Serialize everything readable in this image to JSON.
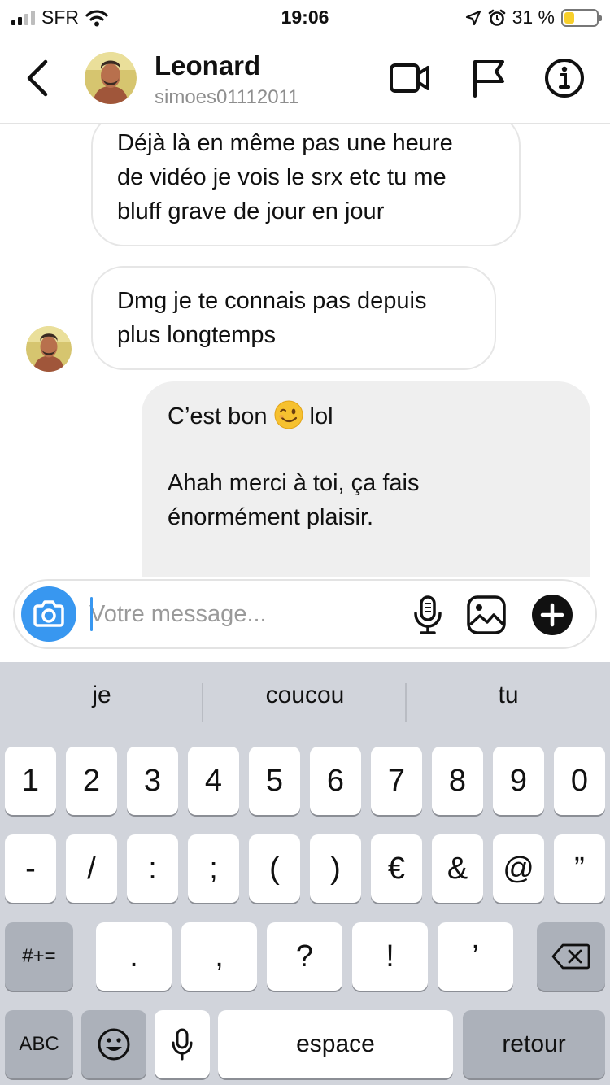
{
  "status_bar": {
    "carrier": "SFR",
    "time": "19:06",
    "battery_percent": "31 %",
    "battery_level": 0.31,
    "icons": [
      "signal-icon",
      "wifi-icon",
      "location-icon",
      "alarm-icon",
      "battery-icon"
    ]
  },
  "header": {
    "contact_name": "Leonard",
    "username": "simoes01112011",
    "icons": [
      "back-chevron-icon",
      "video-call-icon",
      "flag-icon",
      "info-icon"
    ]
  },
  "messages": [
    {
      "direction": "incoming",
      "lines": [
        "Déjà là en même pas une heure",
        "de vidéo je vois le srx etc tu me",
        "bluff grave de jour en jour"
      ]
    },
    {
      "direction": "incoming",
      "lines": [
        "Dmg je te connais pas depuis",
        "plus longtemps"
      ]
    },
    {
      "direction": "outgoing",
      "line1_before": "C’est bon",
      "line1_emoji": "winking-face-emoji",
      "line1_after": "lol",
      "lines": [
        "Ahah merci à toi, ça fais",
        "énormément plaisir."
      ]
    }
  ],
  "composer": {
    "placeholder": "Votre message...",
    "value": "",
    "icons": [
      "camera-icon",
      "microphone-icon",
      "gallery-icon",
      "plus-icon"
    ]
  },
  "keyboard": {
    "suggestions": [
      "je",
      "coucou",
      "tu"
    ],
    "row1": [
      "1",
      "2",
      "3",
      "4",
      "5",
      "6",
      "7",
      "8",
      "9",
      "0"
    ],
    "row2": [
      "-",
      "/",
      ":",
      ";",
      "(",
      ")",
      "€",
      "&",
      "@",
      "”"
    ],
    "row3_mode": "#+=",
    "row3": [
      ".",
      ",",
      "?",
      "!",
      "’"
    ],
    "abc": "ABC",
    "space": "espace",
    "return": "retour",
    "accent_color": "#3897f0",
    "icons": [
      "backspace-icon",
      "emoji-icon",
      "dictation-icon"
    ]
  }
}
